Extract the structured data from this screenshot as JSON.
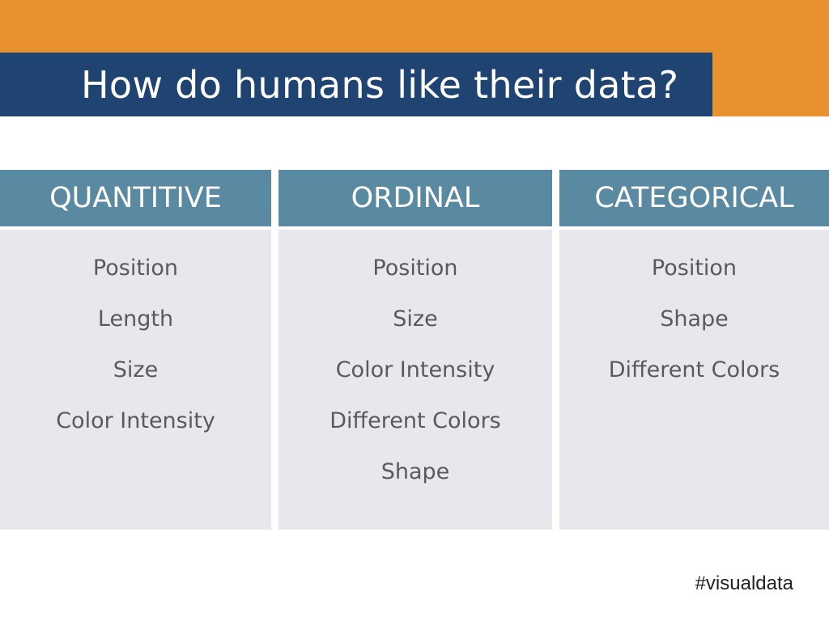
{
  "slide": {
    "title": "How do humans like their data?",
    "hashtag": "#visualdata",
    "colors": {
      "orange_band": "#e9902f",
      "title_bar": "#1f4472",
      "column_header": "#5a8aa1",
      "column_body": "#e8e8ec",
      "item_text": "#5a5a5a"
    }
  },
  "columns": [
    {
      "header": "QUANTITIVE",
      "items": [
        "Position",
        "Length",
        "Size",
        "Color Intensity"
      ]
    },
    {
      "header": "ORDINAL",
      "items": [
        "Position",
        "Size",
        "Color Intensity",
        "Different Colors",
        "Shape"
      ]
    },
    {
      "header": "CATEGORICAL",
      "items": [
        "Position",
        "Shape",
        "Different Colors"
      ]
    }
  ]
}
